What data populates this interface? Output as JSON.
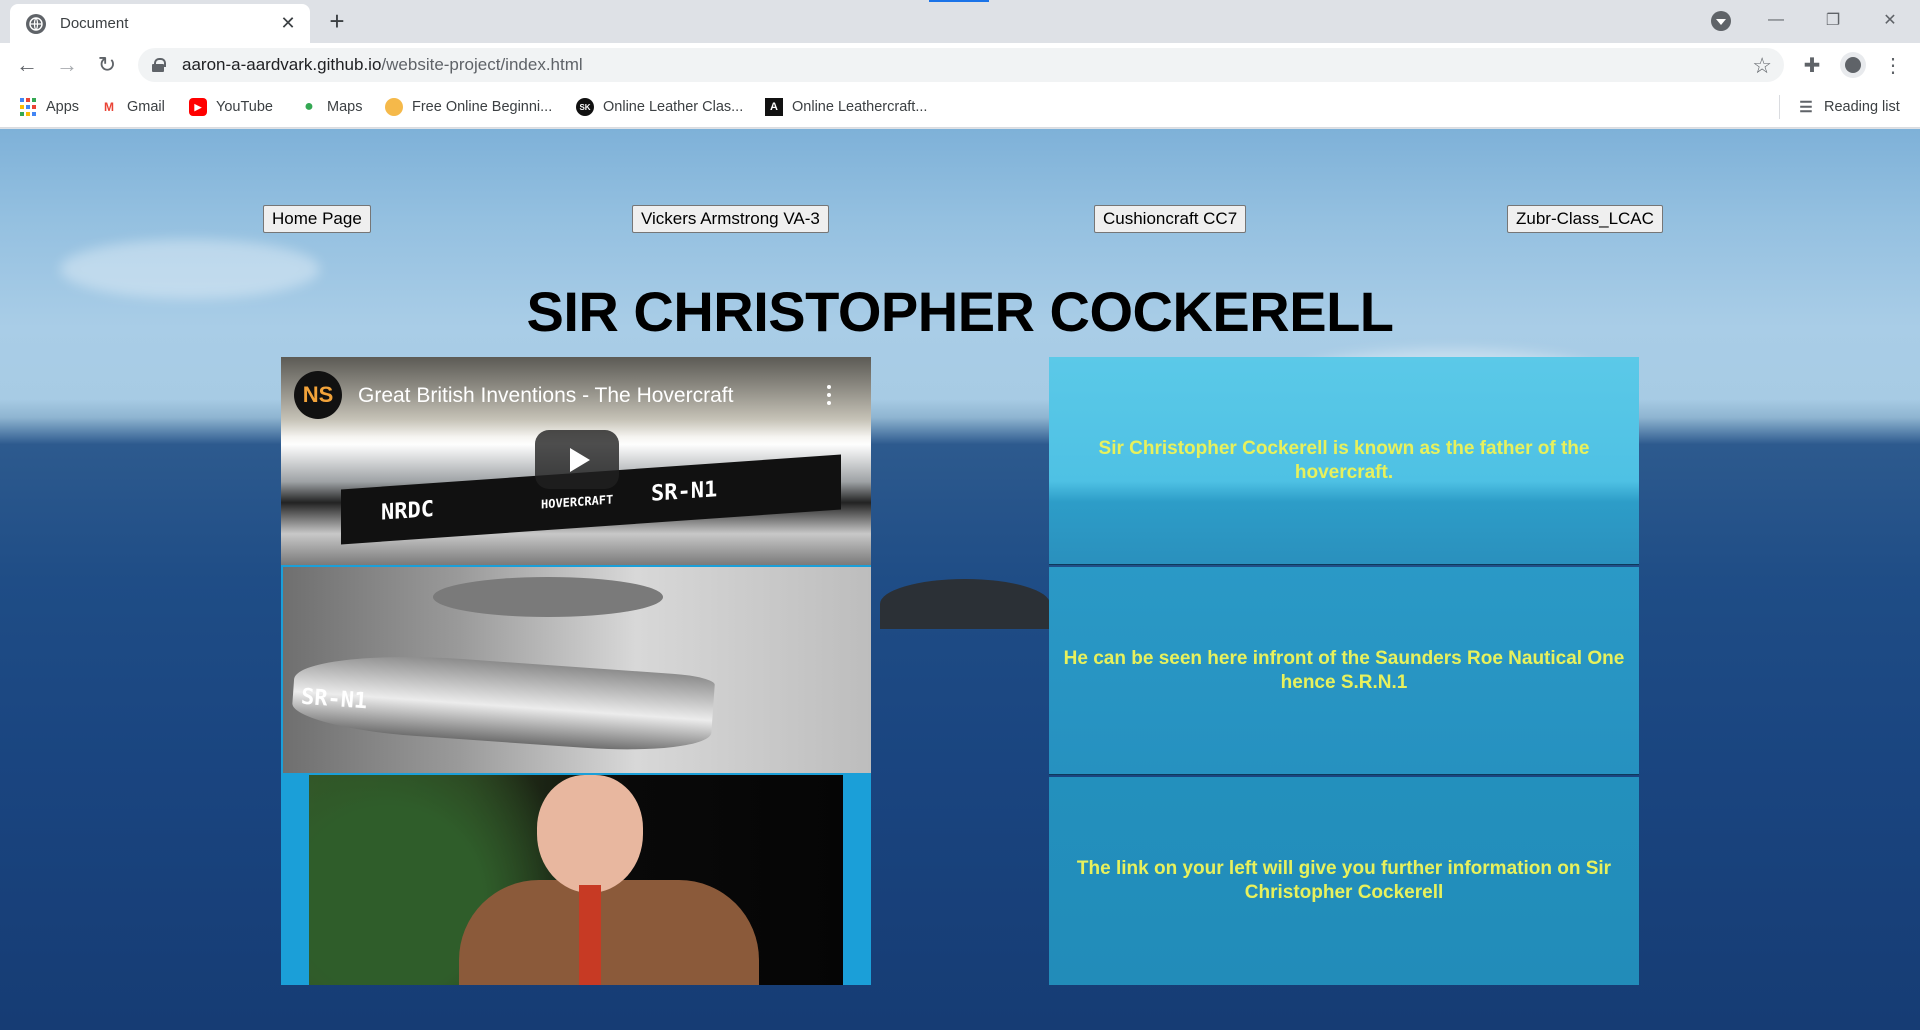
{
  "browser": {
    "tab_title": "Document",
    "url_host": "aaron-a-aardvark.github.io",
    "url_path": "/website-project/index.html",
    "bookmarks": [
      {
        "label": "Apps",
        "icon": "apps-grid-icon"
      },
      {
        "label": "Gmail",
        "icon": "gmail-icon"
      },
      {
        "label": "YouTube",
        "icon": "youtube-icon"
      },
      {
        "label": "Maps",
        "icon": "maps-icon"
      },
      {
        "label": "Free Online Beginni...",
        "icon": "bookmark-favicon"
      },
      {
        "label": "Online Leather Clas...",
        "icon": "bookmark-favicon"
      },
      {
        "label": "Online Leathercraft...",
        "icon": "bookmark-favicon"
      }
    ],
    "reading_list": "Reading list"
  },
  "page": {
    "nav": [
      "Home Page",
      "Vickers Armstrong VA-3",
      "Cushioncraft CC7",
      "Zubr-Class_LCAC"
    ],
    "heading": "SIR CHRISTOPHER COCKERELL",
    "video": {
      "title": "Great British Inventions - The Hovercraft",
      "channel": "NS",
      "hull_left": "NRDC",
      "hull_center": "HOVERCRAFT",
      "hull_right": "SR-N1"
    },
    "photo_label": "SR-N1",
    "info": [
      "Sir Christopher Cockerell is known as the father of the hovercraft.",
      "He can be seen here infront of the Saunders Roe Nautical One hence S.R.N.1",
      "The link on your left will give you further information on Sir Christopher Cockerell"
    ]
  }
}
